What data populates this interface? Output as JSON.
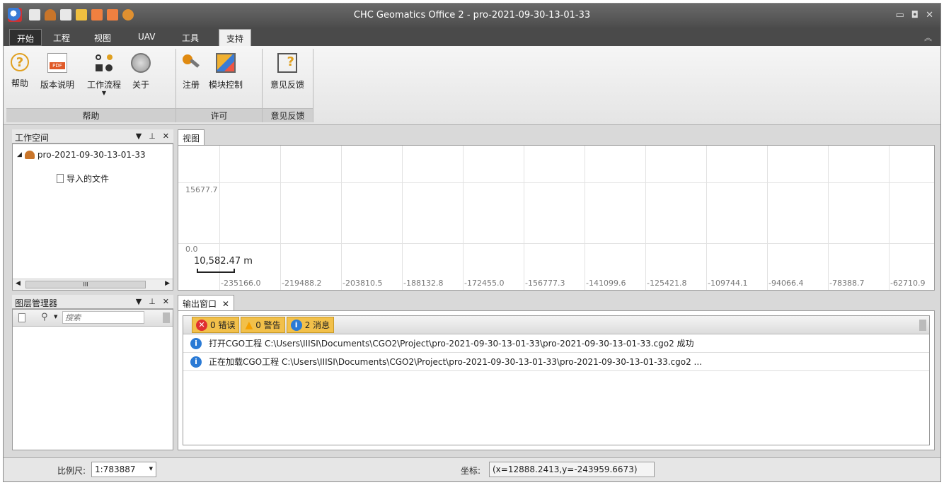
{
  "window": {
    "title": "CHC Geomatics Office 2 - pro-2021-09-30-13-01-33"
  },
  "ribbon": {
    "tabs": [
      "开始",
      "工程",
      "视图",
      "UAV",
      "工具",
      "支持"
    ],
    "active_tab": "支持",
    "groups": {
      "help": {
        "label": "帮助",
        "buttons": [
          "帮助",
          "版本说明",
          "工作流程",
          "关于"
        ]
      },
      "license": {
        "label": "许可",
        "buttons": [
          "注册",
          "模块控制"
        ]
      },
      "feedback": {
        "label": "意见反馈",
        "buttons": [
          "意见反馈"
        ]
      }
    }
  },
  "workspace": {
    "title": "工作空间",
    "project": "pro-2021-09-30-13-01-33",
    "child": "导入的文件",
    "scroll_grip": "III"
  },
  "layers": {
    "title": "图层管理器",
    "search_placeholder": "搜索"
  },
  "view": {
    "tab": "视图",
    "y_ticks": [
      "15677.7",
      "0.0"
    ],
    "x_ticks": [
      "-235166.0",
      "-219488.2",
      "-203810.5",
      "-188132.8",
      "-172455.0",
      "-156777.3",
      "-141099.6",
      "-125421.8",
      "-109744.1",
      "-94066.4",
      "-78388.7",
      "-62710.9"
    ],
    "scale_label": "10,582.47 m"
  },
  "output": {
    "tab": "输出窗口",
    "errors": "0 错误",
    "warnings": "0 警告",
    "messages": "2 消息",
    "rows": [
      "打开CGO工程 C:\\Users\\IIISI\\Documents\\CGO2\\Project\\pro-2021-09-30-13-01-33\\pro-2021-09-30-13-01-33.cgo2 成功",
      "正在加载CGO工程 C:\\Users\\IIISI\\Documents\\CGO2\\Project\\pro-2021-09-30-13-01-33\\pro-2021-09-30-13-01-33.cgo2 ..."
    ]
  },
  "status": {
    "scale_label": "比例尺:",
    "scale_value": "1:783887",
    "coord_label": "坐标:",
    "coord_value": "(x=12888.2413,y=-243959.6673)"
  }
}
